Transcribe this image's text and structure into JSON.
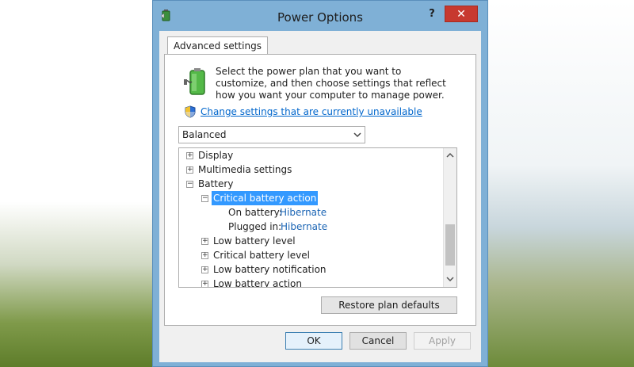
{
  "window": {
    "title": "Power Options",
    "help_label": "?",
    "close_label": "✕",
    "icon": "power-options-icon"
  },
  "tab": {
    "label": "Advanced settings"
  },
  "intro": {
    "text": "Select the power plan that you want to customize, and then choose settings that reflect how you want your computer to manage power.",
    "link": "Change settings that are currently unavailable"
  },
  "plan": {
    "selected": "Balanced"
  },
  "tree": {
    "display": "Display",
    "multimedia": "Multimedia settings",
    "battery": "Battery",
    "critical_action": "Critical battery action",
    "on_battery_label": "On battery:",
    "on_battery_value": "Hibernate",
    "plugged_in_label": "Plugged in:",
    "plugged_in_value": "Hibernate",
    "low_level": "Low battery level",
    "critical_level": "Critical battery level",
    "low_notification": "Low battery notification",
    "low_action": "Low battery action",
    "expand_symbol": "+",
    "collapse_symbol": "−"
  },
  "buttons": {
    "restore": "Restore plan defaults",
    "ok": "OK",
    "cancel": "Cancel",
    "apply": "Apply"
  },
  "colors": {
    "selection": "#3399ff",
    "link": "#0066cc",
    "close": "#c7392f",
    "frame": "#7fb0d6"
  }
}
